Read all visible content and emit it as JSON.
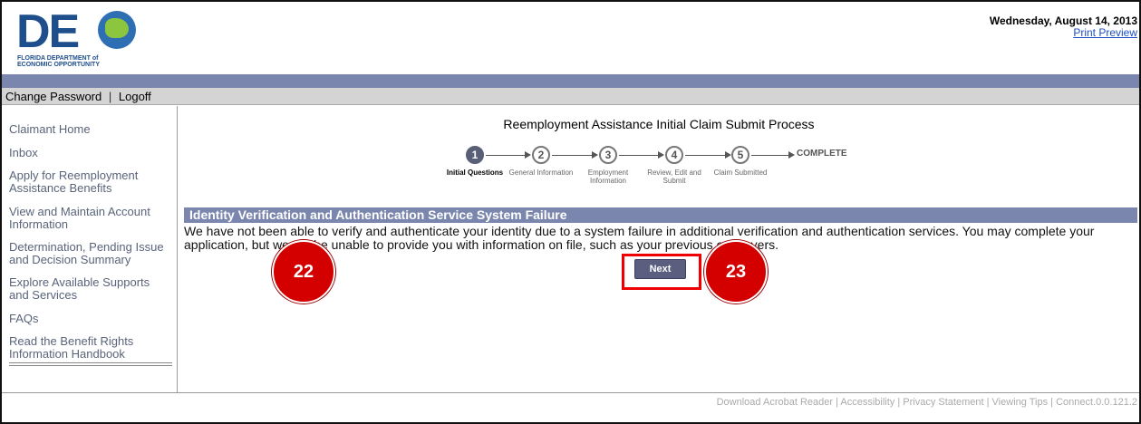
{
  "header": {
    "logo_letters": "DE",
    "logo_subtitle": "FLORIDA DEPARTMENT of\nECONOMIC OPPORTUNITY",
    "date": "Wednesday, August 14, 2013",
    "print_preview": "Print Preview"
  },
  "toolbar": {
    "change_password": "Change Password",
    "separator": "|",
    "logoff": "Logoff"
  },
  "sidebar": {
    "items": [
      {
        "label": "Claimant Home"
      },
      {
        "label": "Inbox"
      },
      {
        "label": "Apply for Reemployment Assistance Benefits"
      },
      {
        "label": "View and Maintain Account Information"
      },
      {
        "label": "Determination, Pending Issue and Decision Summary"
      },
      {
        "label": "Explore Available Supports and Services"
      },
      {
        "label": "FAQs"
      },
      {
        "label": "Read the Benefit Rights Information Handbook"
      }
    ]
  },
  "main": {
    "process_title": "Reemployment Assistance Initial Claim Submit Process",
    "steps": [
      {
        "number": "1",
        "label": "Initial Questions"
      },
      {
        "number": "2",
        "label": "General Information"
      },
      {
        "number": "3",
        "label": "Employment Information"
      },
      {
        "number": "4",
        "label": "Review, Edit and Submit"
      },
      {
        "number": "5",
        "label": "Claim Submitted"
      }
    ],
    "complete_label": "COMPLETE",
    "section_title": "Identity Verification and Authentication Service System Failure",
    "message": "We have not been able to verify and authenticate your identity due to a system failure in additional verification and authentication services. You may complete your application, but we will be unable to provide you with information on file, such as your previous employers.",
    "next_button": "Next"
  },
  "annotations": {
    "badge_left": "22",
    "badge_right": "23"
  },
  "footer": {
    "links": [
      "Download Acrobat Reader",
      "Accessibility",
      "Privacy Statement",
      "Viewing Tips"
    ],
    "version": "Connect.0.0.121.2",
    "separator": "|"
  },
  "colors": {
    "band": "#7a86ad",
    "button": "#5a5f80",
    "highlight": "#ee0000",
    "badge": "#d40000",
    "sidebar_link": "#59647a"
  }
}
